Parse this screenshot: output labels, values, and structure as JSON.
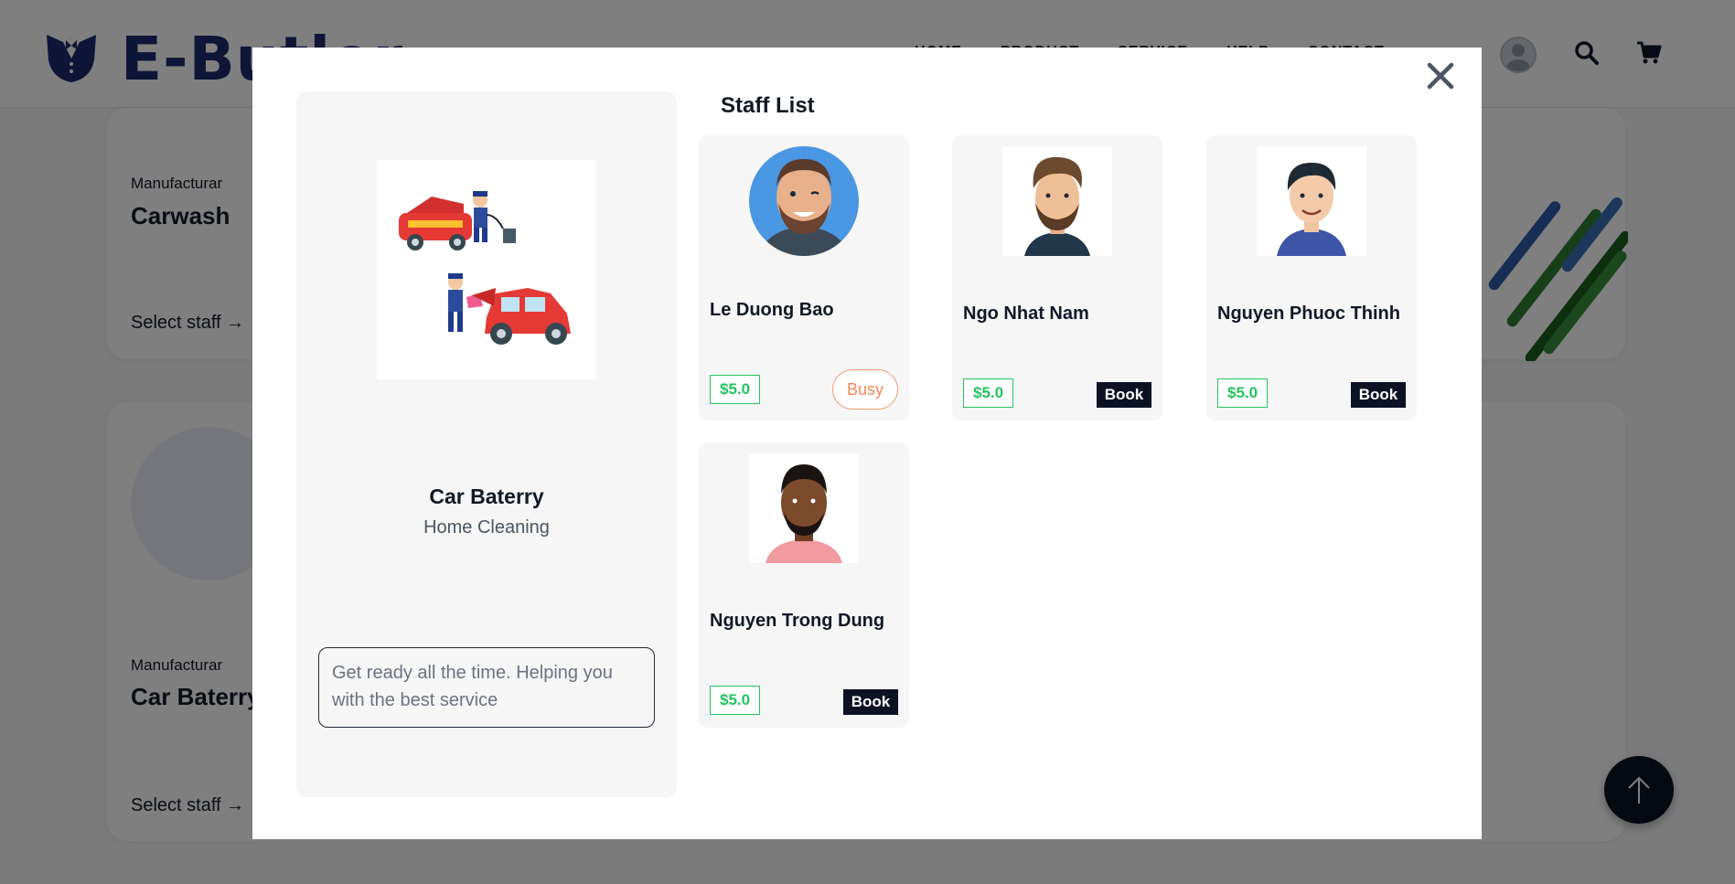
{
  "background": {
    "brand": "E-Butler",
    "nav": [
      "HOME",
      "PRODUCT",
      "SERVICE",
      "HELP",
      "CONTACT"
    ],
    "cards": [
      {
        "label": "Manufacturar",
        "title": "Carwash",
        "link": "Select staff"
      },
      {
        "label": "Manufacturar",
        "title": "Car Baterry",
        "link": "Select staff"
      }
    ]
  },
  "modal": {
    "service": {
      "name": "Car Baterry",
      "category": "Home Cleaning",
      "description": "Get ready all the time. Helping you with the best service"
    },
    "staff_title": "Staff List",
    "staff": [
      {
        "name": "Le Duong Bao",
        "price": "$5.0",
        "action": "Busy"
      },
      {
        "name": "Ngo Nhat Nam",
        "price": "$5.0",
        "action": "Book"
      },
      {
        "name": "Nguyen Phuoc Thinh",
        "price": "$5.0",
        "action": "Book"
      },
      {
        "name": "Nguyen Trong Dung",
        "price": "$5.0",
        "action": "Book"
      }
    ]
  },
  "colors": {
    "brand_navy": "#1e2a6e",
    "dark": "#0b1224",
    "price_green": "#22c55e",
    "busy_orange": "#f28a55"
  },
  "icons": [
    "tuxedo-logo-icon",
    "user-avatar-icon",
    "search-icon",
    "cart-icon",
    "close-icon",
    "arrow-right-icon",
    "arrow-up-icon"
  ]
}
